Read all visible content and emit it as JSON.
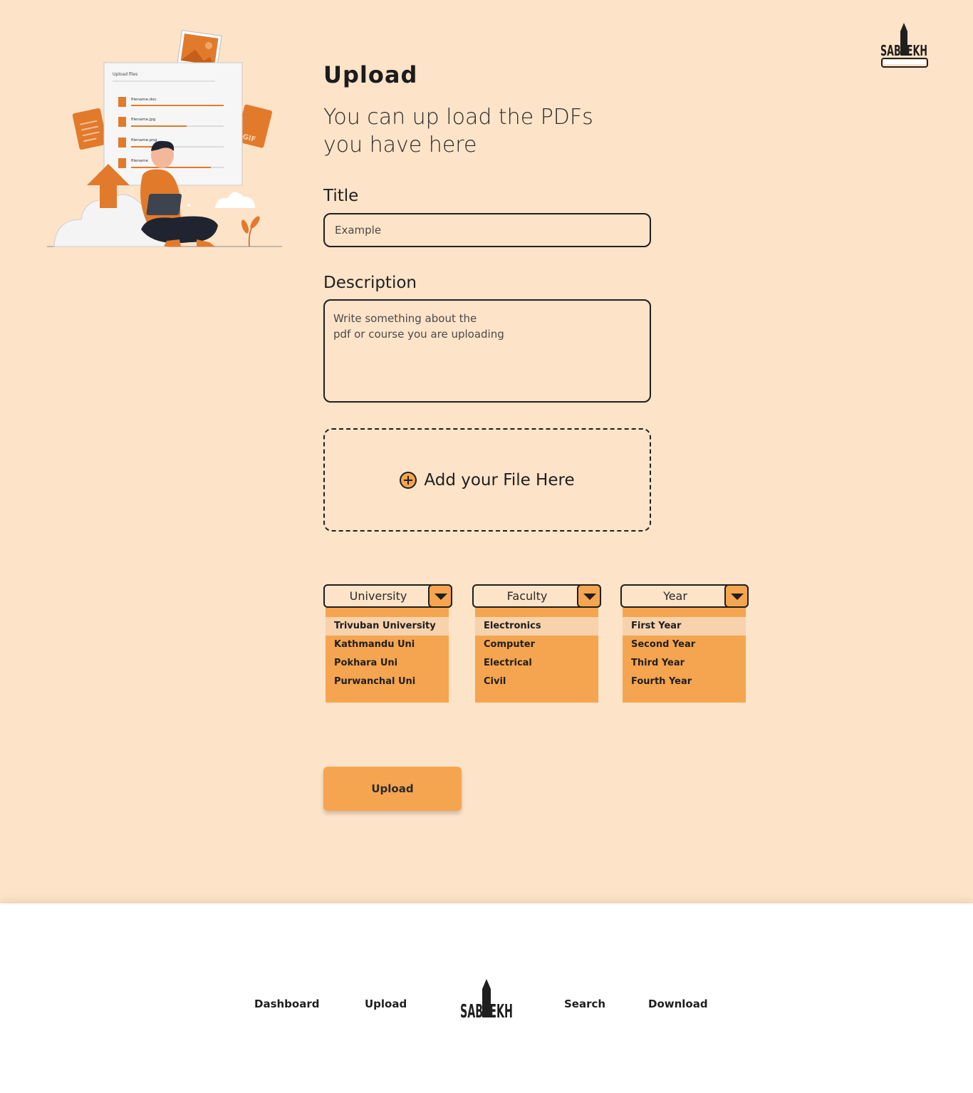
{
  "brand": {
    "logo_text": "SABLEKH"
  },
  "hero": {
    "panel_title": "Upload files",
    "files": [
      "filename.doc",
      "filename.jpg",
      "filename.png",
      "filename"
    ],
    "gif_label": "GIF"
  },
  "page": {
    "title": "Upload",
    "subtitle": "You can up load the PDFs you have here"
  },
  "form": {
    "title_label": "Title",
    "title_placeholder": "Example",
    "description_label": "Description",
    "description_placeholder": "Write something about the\npdf or course you are uploading",
    "dropzone_label": "Add your File Here",
    "submit_label": "Upload"
  },
  "dropdowns": {
    "university": {
      "label": "University",
      "options": [
        "Trivuban University",
        "Kathmandu Uni",
        "Pokhara Uni",
        "Purwanchal Uni"
      ]
    },
    "faculty": {
      "label": "Faculty",
      "options": [
        "Electronics",
        "Computer",
        "Electrical",
        "Civil"
      ]
    },
    "year": {
      "label": "Year",
      "options": [
        "First Year",
        "Second Year",
        "Third Year",
        "Fourth Year"
      ]
    }
  },
  "footer": {
    "nav": [
      "Dashboard",
      "Upload",
      "Search",
      "Download"
    ]
  },
  "colors": {
    "background": "#fde3c8",
    "accent": "#f5a54f",
    "highlight": "#f6d2ad",
    "ink": "#1f1f1f"
  }
}
